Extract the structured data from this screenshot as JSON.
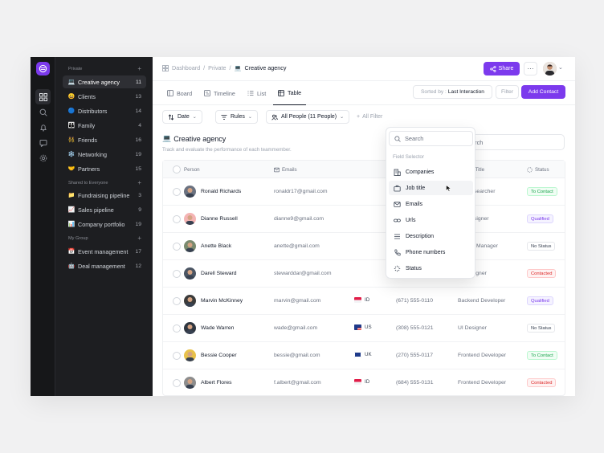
{
  "sidebar": {
    "sections": [
      {
        "label": "Private"
      },
      {
        "label": "Shared to Everyone"
      },
      {
        "label": "My Group"
      }
    ],
    "items": [
      {
        "emoji": "💻",
        "label": "Creative agency",
        "count": "11"
      },
      {
        "emoji": "😀",
        "label": "Clients",
        "count": "13"
      },
      {
        "emoji": "🔵",
        "label": "Distributors",
        "count": "14"
      },
      {
        "emoji": "👪",
        "label": "Family",
        "count": "4"
      },
      {
        "emoji": "👯",
        "label": "Friends",
        "count": "16"
      },
      {
        "emoji": "❄️",
        "label": "Networking",
        "count": "19"
      },
      {
        "emoji": "🤝",
        "label": "Partners",
        "count": "15"
      },
      {
        "emoji": "📁",
        "label": "Fundraising pipeline",
        "count": "3"
      },
      {
        "emoji": "📈",
        "label": "Sales pipeline",
        "count": "9"
      },
      {
        "emoji": "📊",
        "label": "Company portfolio",
        "count": "19"
      },
      {
        "emoji": "📅",
        "label": "Event management",
        "count": "17"
      },
      {
        "emoji": "🤖",
        "label": "Deal management",
        "count": "12"
      }
    ]
  },
  "breadcrumb": {
    "items": [
      "Dashboard",
      "Private"
    ],
    "sep": "/",
    "current_emoji": "💻",
    "current": "Creative agency"
  },
  "header": {
    "share": "Share",
    "more": "···"
  },
  "tabs": [
    "Board",
    "Timeline",
    "List",
    "Table"
  ],
  "sort": {
    "label": "Sorted by :",
    "value": "Last Interaction"
  },
  "filter_label": "Filter",
  "add_contact": "Add Contact",
  "filters": {
    "date": "Date",
    "rules": "Rules",
    "people": "All People (11 People)",
    "all_filter": "All Filter"
  },
  "page": {
    "emoji": "💻",
    "title": "Creative agency",
    "subtitle": "Track and evaluate the performance of each teammember."
  },
  "search_placeholder": "Search",
  "table": {
    "headers": {
      "person": "Person",
      "emails": "Emails",
      "job_title": "Job Title",
      "status": "Status"
    },
    "rows": [
      {
        "name": "Ronald Richards",
        "email": "ronaldr17@gmail.com",
        "country": "",
        "phone": "",
        "job": "UX Researcher",
        "status": "To Contact"
      },
      {
        "name": "Dianne Russell",
        "email": "dianne9@gmail.com",
        "country": "",
        "phone": "",
        "job": "UX Designer",
        "status": "Qualified"
      },
      {
        "name": "Anette Black",
        "email": "anette@gmail.com",
        "country": "",
        "phone": "",
        "job": "Project Manager",
        "status": "No Status"
      },
      {
        "name": "Darell Steward",
        "email": "stewarddar@gmail.com",
        "country": "",
        "phone": "",
        "job": "UI Designer",
        "status": "Contacted"
      },
      {
        "name": "Marvin McKinney",
        "email": "marvin@gmail.com",
        "country": "ID",
        "phone": "(671) 555-0110",
        "job": "Backend Developer",
        "status": "Qualified"
      },
      {
        "name": "Wade Warren",
        "email": "wade@gmail.com",
        "country": "US",
        "phone": "(308) 555-0121",
        "job": "UI Designer",
        "status": "No Status"
      },
      {
        "name": "Bessie Cooper",
        "email": "bessie@gmail.com",
        "country": "UK",
        "phone": "(270) 555-0117",
        "job": "Frontend Developer",
        "status": "To Contact"
      },
      {
        "name": "Albert Flores",
        "email": "f.albert@gmail.com",
        "country": "ID",
        "phone": "(684) 555-0131",
        "job": "Frontend Developer",
        "status": "Contacted"
      }
    ]
  },
  "dropdown": {
    "search_placeholder": "Search",
    "section": "Field Selector",
    "items": [
      "Companies",
      "Job title",
      "Emails",
      "Urls",
      "Description",
      "Phone numbers",
      "Status"
    ]
  },
  "colors": {
    "accent": "#7c3aed",
    "sidebar_bg": "#1d1e21",
    "rail_bg": "#161719"
  }
}
